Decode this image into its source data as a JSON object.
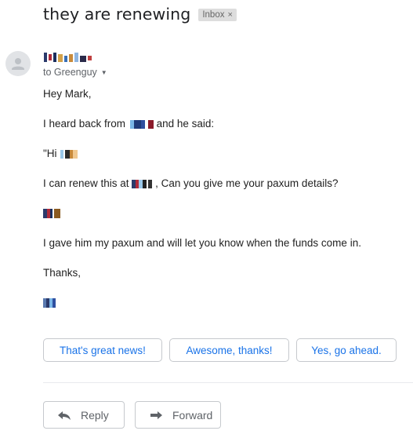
{
  "subject": "they are renewing",
  "label": {
    "text": "Inbox",
    "remove": "×"
  },
  "sender": {
    "to_text": "to Greenguy"
  },
  "body": {
    "greeting": "Hey Mark,",
    "line1_pre": "I heard back from",
    "line1_post": "and he said:",
    "line2_pre": "\"Hi",
    "line3_pre": "I can renew this at",
    "line3_post": ", Can you give me your paxum details?",
    "line5": "I gave him my paxum and will let you know when the funds come in.",
    "thanks": "Thanks,"
  },
  "smart_replies": [
    "That's great news!",
    "Awesome, thanks!",
    "Yes, go ahead."
  ],
  "actions": {
    "reply": "Reply",
    "forward": "Forward"
  },
  "colors": {
    "link_blue": "#1a73e8",
    "muted": "#5f6368",
    "chip_bg": "#dddddd"
  }
}
